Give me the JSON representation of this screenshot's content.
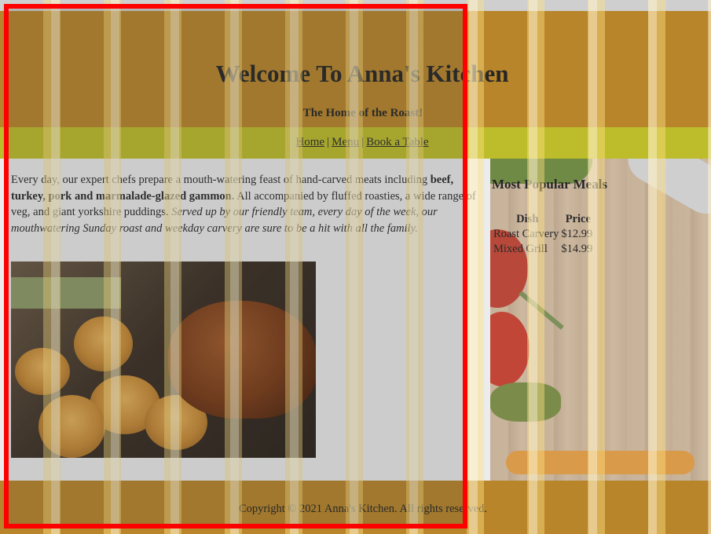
{
  "header": {
    "title": "Welcome To Anna's Kitchen",
    "tagline": "The Home of the Roast!"
  },
  "nav": {
    "items": [
      "Home",
      "Menu",
      "Book a Table"
    ],
    "separator": "|"
  },
  "intro": {
    "part1": "Every day, our expert chefs prepare a mouth-watering feast of hand-carved meats including ",
    "bold": "beef, turkey, pork and marmalade-glazed gammon.",
    "part2": " All accompanied by fluffed roasties, a wide range of veg, and giant yorkshire puddings. ",
    "italic": "Served up by our friendly team, every day of the week, our mouthwatering Sunday roast and weekday carvery are sure to be a hit with all the family."
  },
  "popular": {
    "heading": "Most Popular Meals",
    "columns": [
      "Dish",
      "Price"
    ],
    "rows": [
      {
        "dish": "Roast Carvery",
        "price": "$12.99"
      },
      {
        "dish": "Mixed Grill",
        "price": "$14.99"
      }
    ]
  },
  "footer": {
    "copyright": "Copyright © 2021 Anna's Kitchen. All rights reserved."
  },
  "colors": {
    "header_bg": "#b8852a",
    "nav_bg": "#bdbd2b",
    "highlight": "#ff0000"
  },
  "images": {
    "hero": "carvery-photo",
    "background": "chopping-board-vegetables"
  }
}
